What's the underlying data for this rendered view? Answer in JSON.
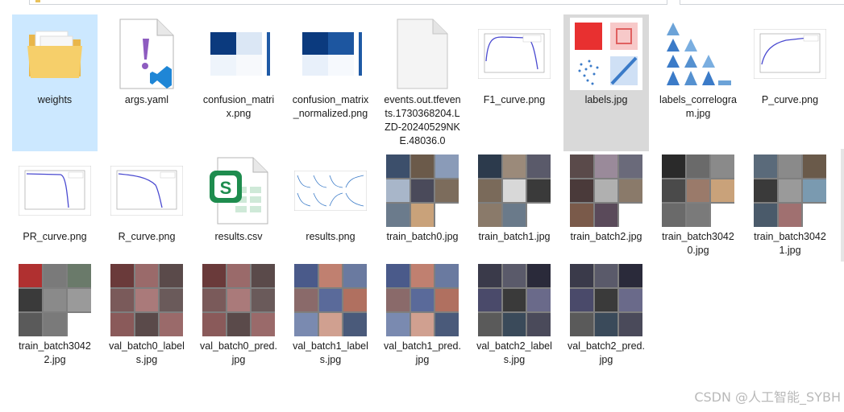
{
  "files": [
    {
      "name": "weights",
      "icon": "folder-icon",
      "state": "selected"
    },
    {
      "name": "args.yaml",
      "icon": "yaml-file-icon"
    },
    {
      "name": "confusion_matrix.png",
      "icon": "confusion-matrix-thumbnail"
    },
    {
      "name": "confusion_matrix_normalized.png",
      "icon": "confusion-matrix-normalized-thumbnail"
    },
    {
      "name": "events.out.tfevents.1730368204.LZD-20240529NKE.48036.0",
      "icon": "blank-file-icon"
    },
    {
      "name": "F1_curve.png",
      "icon": "f1-curve-thumbnail"
    },
    {
      "name": "labels.jpg",
      "icon": "labels-thumbnail",
      "state": "hovered"
    },
    {
      "name": "labels_correlogram.jpg",
      "icon": "labels-correlogram-thumbnail"
    },
    {
      "name": "P_curve.png",
      "icon": "p-curve-thumbnail"
    },
    {
      "name": "PR_curve.png",
      "icon": "pr-curve-thumbnail"
    },
    {
      "name": "R_curve.png",
      "icon": "r-curve-thumbnail"
    },
    {
      "name": "results.csv",
      "icon": "csv-file-icon"
    },
    {
      "name": "results.png",
      "icon": "results-thumbnail"
    },
    {
      "name": "train_batch0.jpg",
      "icon": "train-batch-thumbnail"
    },
    {
      "name": "train_batch1.jpg",
      "icon": "train-batch-thumbnail"
    },
    {
      "name": "train_batch2.jpg",
      "icon": "train-batch-thumbnail"
    },
    {
      "name": "train_batch30420.jpg",
      "icon": "train-batch-thumbnail"
    },
    {
      "name": "train_batch30421.jpg",
      "icon": "train-batch-thumbnail"
    },
    {
      "name": "train_batch30422.jpg",
      "icon": "train-batch-thumbnail"
    },
    {
      "name": "val_batch0_labels.jpg",
      "icon": "val-batch-thumbnail"
    },
    {
      "name": "val_batch0_pred.jpg",
      "icon": "val-batch-thumbnail"
    },
    {
      "name": "val_batch1_labels.jpg",
      "icon": "val-batch-thumbnail"
    },
    {
      "name": "val_batch1_pred.jpg",
      "icon": "val-batch-thumbnail"
    },
    {
      "name": "val_batch2_labels.jpg",
      "icon": "val-batch-thumbnail"
    },
    {
      "name": "val_batch2_pred.jpg",
      "icon": "val-batch-thumbnail"
    }
  ],
  "watermark": "CSDN @人工智能_SYBH",
  "colors": {
    "selected": "#cce8ff",
    "hovered": "#d9d9d9",
    "folder": "#f3c65a",
    "csv_green": "#1e8c4e"
  }
}
